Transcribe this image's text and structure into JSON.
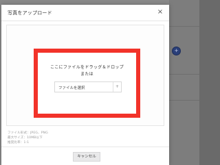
{
  "dialog": {
    "title": "写真をアップロード",
    "close_icon": "×"
  },
  "dropzone": {
    "line1": "ここにファイルをドラッグ＆ドロップ",
    "line2": "または",
    "select_label": "ファイルを選択",
    "select_plus": "+"
  },
  "info": {
    "line1": "ファイル形式：JPEG、PNG",
    "line2": "最大サイズ：10MB以下",
    "line3": "推奨比率：1:1"
  },
  "footer": {
    "cancel_label": "キャンセル"
  },
  "background": {
    "badge": "+"
  },
  "colors": {
    "highlight": "#f2332a",
    "badge": "#2a3f78"
  }
}
